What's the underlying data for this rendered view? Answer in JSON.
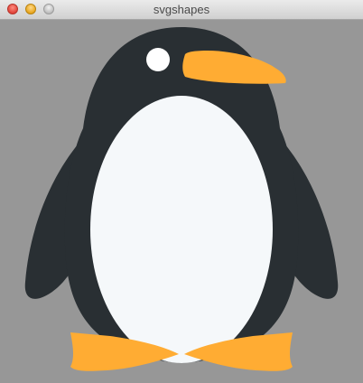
{
  "window": {
    "title": "svgshapes"
  },
  "colors": {
    "background": "#979797",
    "body": "#292f33",
    "belly": "#f5f8fa",
    "beak_and_feet": "#ffac33",
    "eye": "#ffffff"
  },
  "icons": {
    "close": "close-button-icon",
    "minimize": "minimize-button-icon",
    "zoom": "zoom-button-icon"
  }
}
